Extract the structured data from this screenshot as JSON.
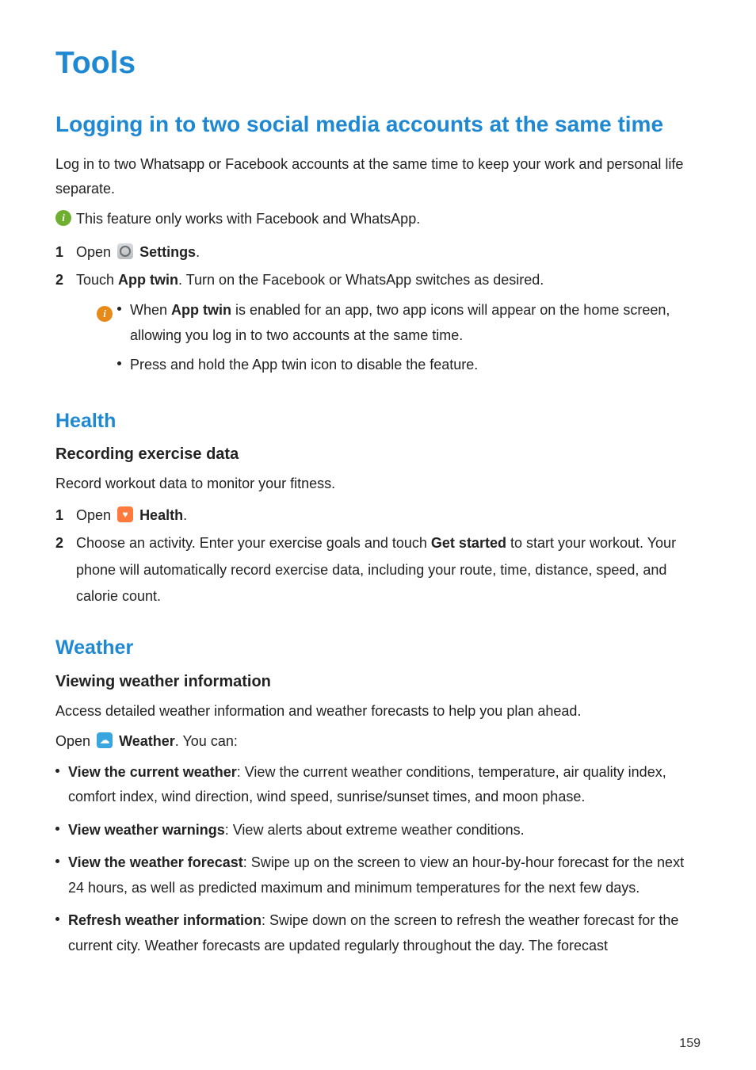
{
  "page_title": "Tools",
  "page_number": "159",
  "sections": {
    "social": {
      "heading": "Logging in to two social media accounts at the same time",
      "intro": "Log in to two Whatsapp or Facebook accounts at the same time to keep your work and personal life separate.",
      "note": "This feature only works with Facebook and WhatsApp.",
      "steps": {
        "s1_a": "Open ",
        "s1_b": "Settings",
        "s1_c": ".",
        "s2_a": "Touch ",
        "s2_b": "App twin",
        "s2_c": ". Turn on the Facebook or WhatsApp switches as desired."
      },
      "sub": {
        "b1_a": "When ",
        "b1_b": "App twin",
        "b1_c": " is enabled for an app, two app icons will appear on the home screen, allowing you log in to two accounts at the same time.",
        "b2": "Press and hold the App twin icon to disable the feature."
      }
    },
    "health": {
      "heading": "Health",
      "sub_heading": "Recording exercise data",
      "intro": "Record workout data to monitor your fitness.",
      "steps": {
        "s1_a": "Open ",
        "s1_b": "Health",
        "s1_c": ".",
        "s2_a": "Choose an activity. Enter your exercise goals and touch ",
        "s2_b": "Get started",
        "s2_c": " to start your workout. Your phone will automatically record exercise data, including your route, time, distance, speed, and calorie count."
      }
    },
    "weather": {
      "heading": "Weather",
      "sub_heading": "Viewing weather information",
      "intro": "Access detailed weather information and weather forecasts to help you plan ahead.",
      "open_a": "Open ",
      "open_b": "Weather",
      "open_c": ". You can:",
      "items": {
        "i1_b": "View the current weather",
        "i1_t": ": View the current weather conditions, temperature, air quality index, comfort index, wind direction, wind speed, sunrise/sunset times, and moon phase.",
        "i2_b": "View weather warnings",
        "i2_t": ": View alerts about extreme weather conditions.",
        "i3_b": "View the weather forecast",
        "i3_t": ": Swipe up on the screen to view an hour-by-hour forecast for the next 24 hours, as well as predicted maximum and minimum temperatures for the next few days.",
        "i4_b": "Refresh weather information",
        "i4_t": ": Swipe down on the screen to refresh the weather forecast for the current city. Weather forecasts are updated regularly throughout the day. The forecast"
      }
    }
  }
}
